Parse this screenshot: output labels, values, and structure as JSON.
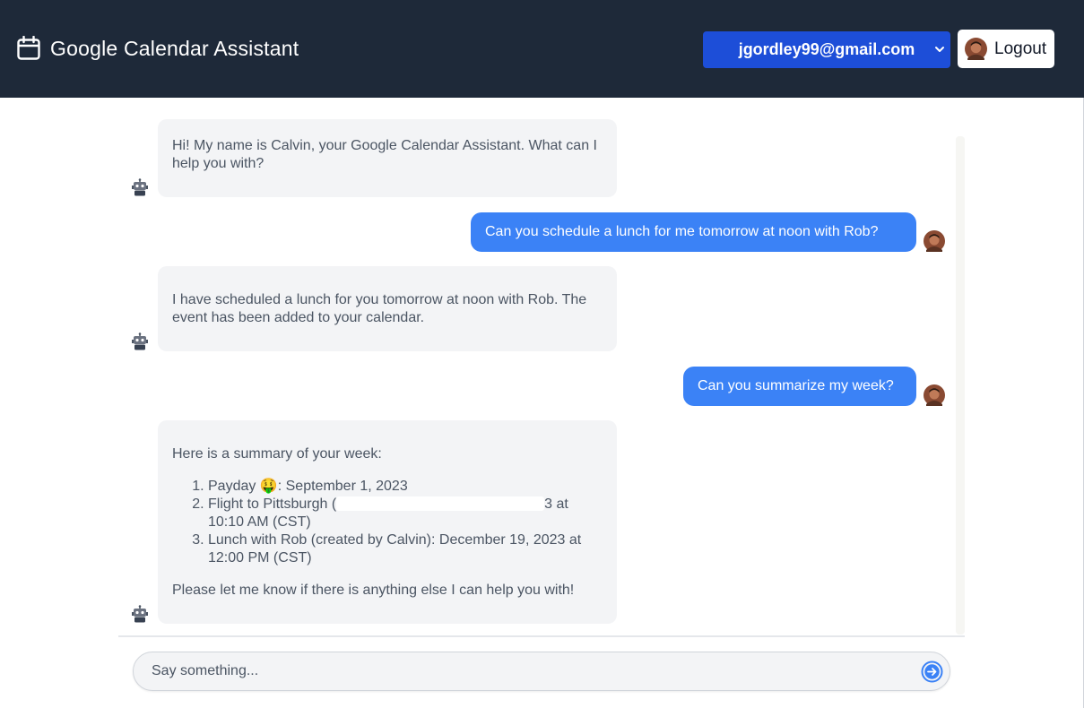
{
  "header": {
    "title": "Google Calendar Assistant",
    "account": "jgordley99@gmail.com",
    "logout_label": "Logout"
  },
  "messages": [
    {
      "role": "bot",
      "text": "Hi! My name is Calvin, your Google Calendar Assistant. What can I help you with?"
    },
    {
      "role": "user",
      "text": "Can you schedule a lunch for me tomorrow at noon with Rob?"
    },
    {
      "role": "bot",
      "text": "I have scheduled a lunch for you tomorrow at noon with Rob. The event has been added to your calendar."
    },
    {
      "role": "user",
      "text": "Can you summarize my week?"
    },
    {
      "role": "bot",
      "intro": "Here is a summary of your week:",
      "items": [
        {
          "before": "Payday ",
          "emoji": "🤑",
          "after": ": September 1, 2023"
        },
        {
          "before": "Flight to Pittsburgh (",
          "after": "3 at 10:10 AM (CST)"
        },
        {
          "text": "Lunch with Rob (created by Calvin): December 19, 2023 at 12:00 PM (CST)"
        }
      ],
      "outro": "Please let me know if there is anything else I can help you with!"
    }
  ],
  "composer": {
    "placeholder": "Say something..."
  },
  "colors": {
    "header_bg": "#1e2939",
    "account_select_bg": "#1d4ed8",
    "user_bubble_bg": "#3b82f6",
    "bot_bubble_bg": "#f3f4f6"
  },
  "icons": {
    "brand": "calendar-icon",
    "bot": "robot-icon",
    "user": "user-avatar",
    "send": "send-arrow-icon",
    "select": "chevron-down-icon"
  }
}
